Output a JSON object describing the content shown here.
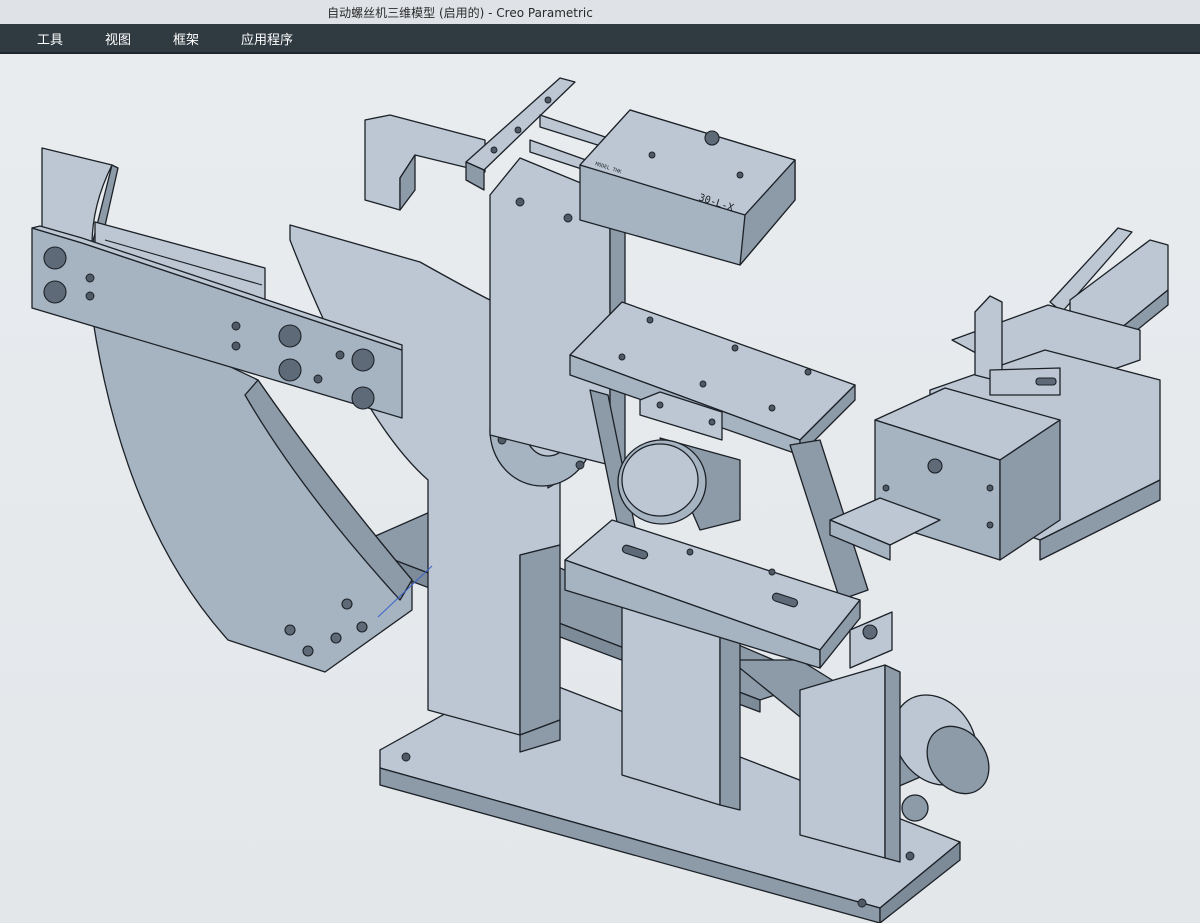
{
  "window": {
    "title": "自动螺丝机三维模型 (启用的) - Creo Parametric"
  },
  "menu": {
    "items": [
      {
        "id": "tools",
        "label": "工具"
      },
      {
        "id": "view",
        "label": "视图"
      },
      {
        "id": "frame",
        "label": "框架"
      },
      {
        "id": "apps",
        "label": "应用程序"
      }
    ]
  },
  "model": {
    "cylinder_label_small": "MODEL THK",
    "cylinder_label_main": "30-L-X"
  },
  "colors": {
    "model_face": "#a6b3c1",
    "model_edge": "#1c2127",
    "menubar": "#2f3a41",
    "background": "#e4e8ec",
    "datum_axis": "#3a63c8"
  }
}
